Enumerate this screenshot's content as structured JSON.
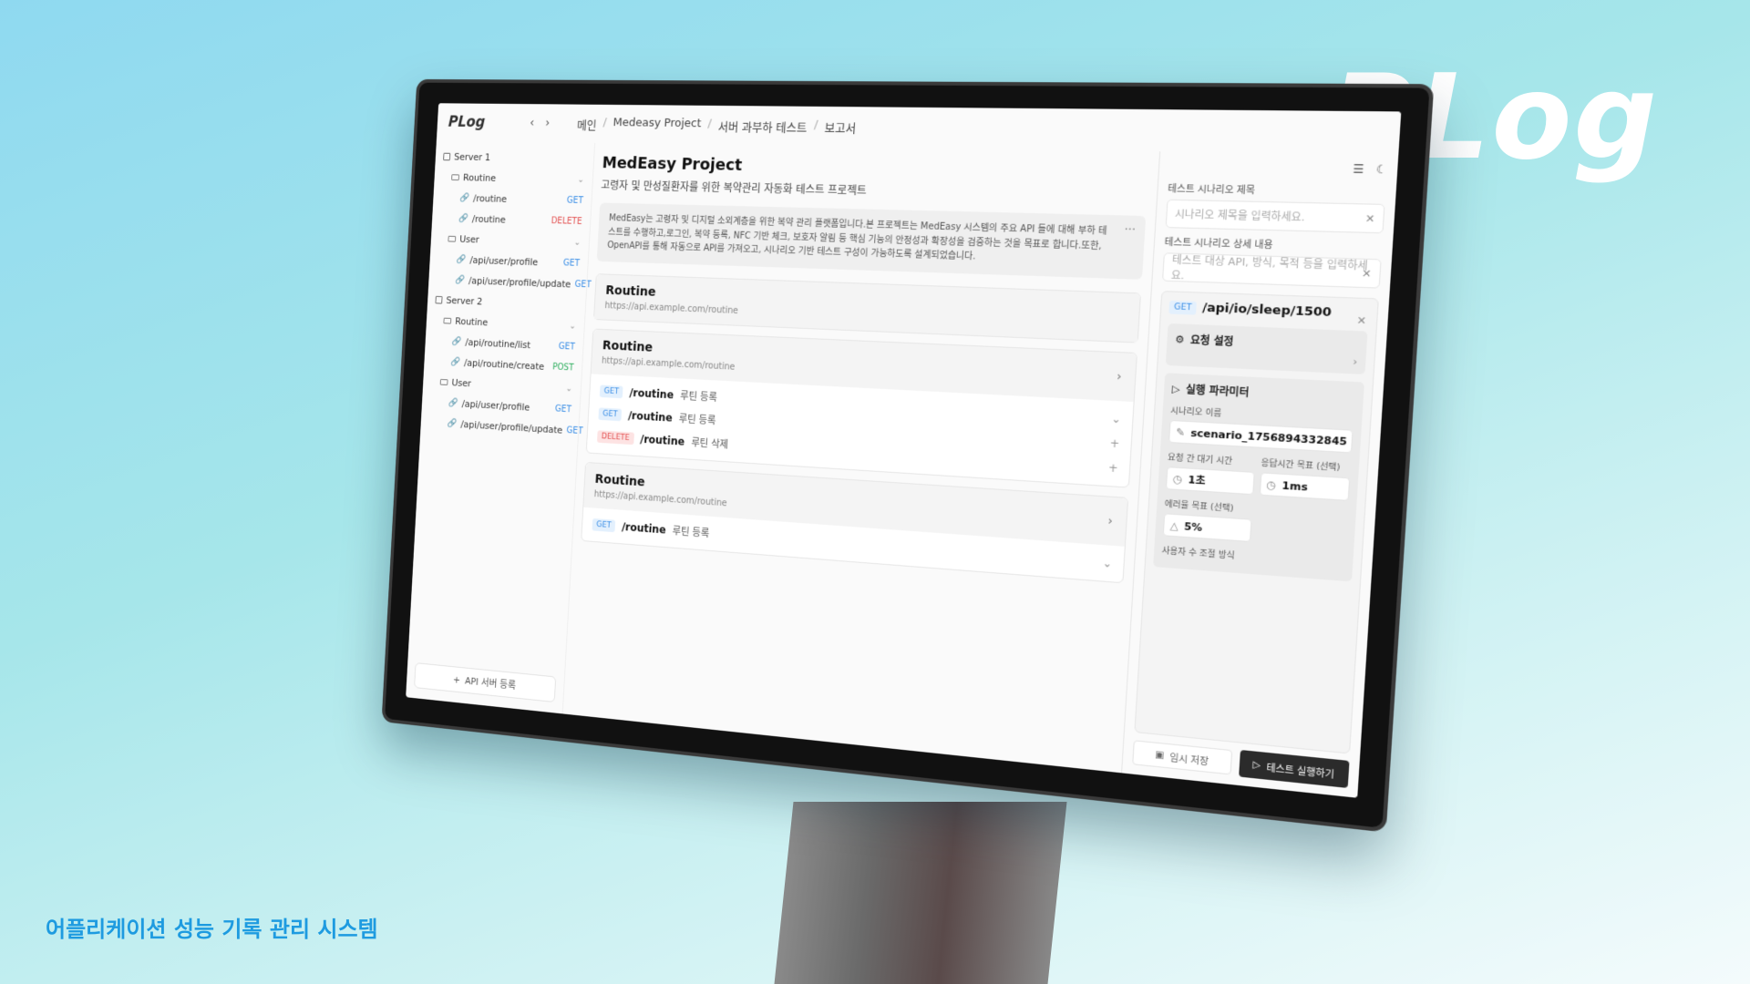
{
  "brand": "PLog",
  "tagline": "어플리케이션 성능 기록 관리 시스템",
  "app": {
    "logo": "PLog"
  },
  "breadcrumb": [
    "메인",
    "Medeasy Project",
    "서버 과부하 테스트",
    "보고서"
  ],
  "sidebar": {
    "items": [
      {
        "label": "Server 1",
        "type": "server",
        "level": 0,
        "method": ""
      },
      {
        "label": "Routine",
        "type": "folder",
        "level": 1,
        "method": ""
      },
      {
        "label": "/routine",
        "type": "link",
        "level": 2,
        "method": "GET",
        "color": "#3a8ee6"
      },
      {
        "label": "/routine",
        "type": "link",
        "level": 2,
        "method": "DELETE",
        "color": "#e35050"
      },
      {
        "label": "User",
        "type": "folder",
        "level": 1,
        "method": ""
      },
      {
        "label": "/api/user/profile",
        "type": "link",
        "level": 2,
        "method": "GET",
        "color": "#3a8ee6"
      },
      {
        "label": "/api/user/profile/update",
        "type": "link",
        "level": 2,
        "method": "GET",
        "color": "#3a8ee6"
      },
      {
        "label": "Server 2",
        "type": "server",
        "level": 0,
        "method": ""
      },
      {
        "label": "Routine",
        "type": "folder",
        "level": 1,
        "method": ""
      },
      {
        "label": "/api/routine/list",
        "type": "link",
        "level": 2,
        "method": "GET",
        "color": "#3a8ee6"
      },
      {
        "label": "/api/routine/create",
        "type": "link",
        "level": 2,
        "method": "POST",
        "color": "#2fae5f"
      },
      {
        "label": "User",
        "type": "folder",
        "level": 1,
        "method": ""
      },
      {
        "label": "/api/user/profile",
        "type": "link",
        "level": 2,
        "method": "GET",
        "color": "#3a8ee6"
      },
      {
        "label": "/api/user/profile/update",
        "type": "link",
        "level": 2,
        "method": "GET",
        "color": "#3a8ee6"
      }
    ],
    "add_server": "API 서버 등록"
  },
  "main": {
    "title": "MedEasy Project",
    "subtitle": "고령자 및 만성질환자를 위한 복약관리 자동화 테스트 프로젝트",
    "description": "MedEasy는 고령자 및 디지털 소외계층을 위한 복약 관리 플랫폼입니다.본 프로젝트는 MedEasy 시스템의 주요 API 들에 대해 부하 테스트를 수행하고,로그인, 복약 등록, NFC 기반 체크, 보호자 알림 등 핵심 기능의 안정성과 확장성을 검증하는 것을 목표로 합니다.또한, OpenAPI를 통해 자동으로 API를 가져오고, 시나리오 기반 테스트 구성이 가능하도록 설계되었습니다.",
    "cards": [
      {
        "title": "Routine",
        "url": "https://api.example.com/routine",
        "endpoints": []
      },
      {
        "title": "Routine",
        "url": "https://api.example.com/routine",
        "endpoints": [
          {
            "method": "GET",
            "path": "/routine",
            "desc": "루틴 등록"
          },
          {
            "method": "GET",
            "path": "/routine",
            "desc": "루틴 등록"
          },
          {
            "method": "DELETE",
            "path": "/routine",
            "desc": "루틴 삭제"
          }
        ]
      },
      {
        "title": "Routine",
        "url": "https://api.example.com/routine",
        "endpoints": [
          {
            "method": "GET",
            "path": "/routine",
            "desc": "루틴 등록"
          }
        ]
      }
    ]
  },
  "panel": {
    "scenario_title_label": "테스트 시나리오 제목",
    "scenario_title_placeholder": "시나리오 제목을 입력하세요.",
    "scenario_detail_label": "테스트 시나리오 상세 내용",
    "scenario_detail_placeholder": "테스트 대상 API, 방식, 목적 등을 입력하세요.",
    "request": {
      "method": "GET",
      "path": "/api/io/sleep/1500",
      "settings_label": "요청 설정",
      "params_label": "실행 파라미터",
      "scenario_name_label": "시나리오 이름",
      "scenario_name_value": "scenario_1756894332845",
      "wait_label": "요청 간 대기 시간",
      "wait_value": "1초",
      "response_target_label": "응답시간 목표 (선택)",
      "response_target_value": "1ms",
      "error_target_label": "에러율 목표 (선택)",
      "error_target_value": "5%",
      "user_control_label": "사용자 수 조절 방식"
    },
    "save_label": "임시 저장",
    "run_label": "테스트 실행하기"
  }
}
